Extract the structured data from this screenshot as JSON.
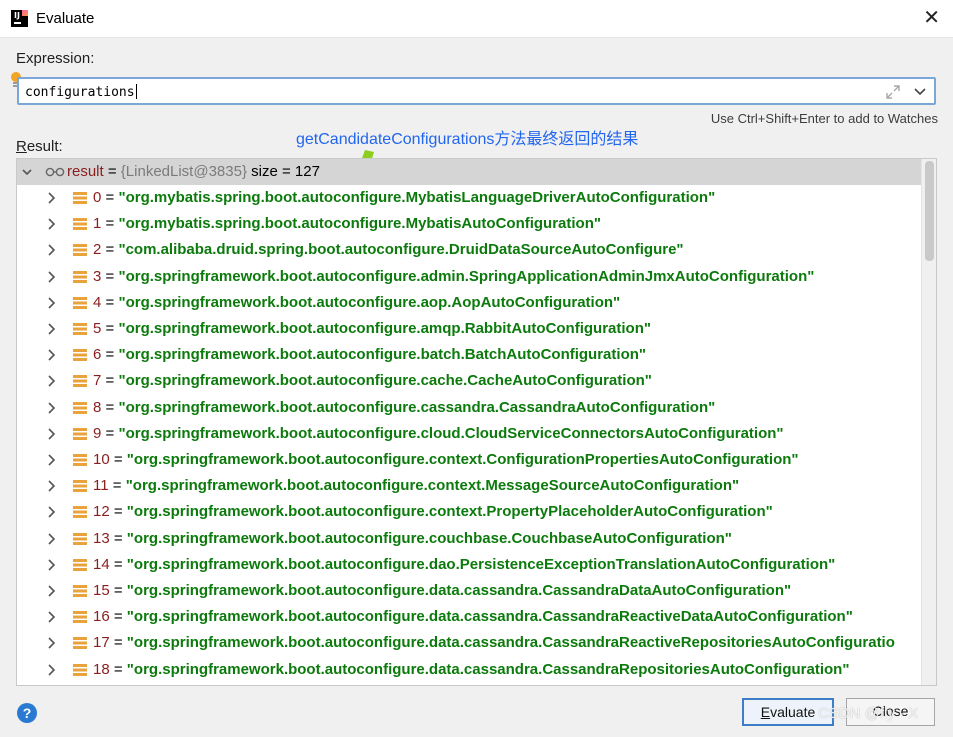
{
  "window": {
    "title": "Evaluate",
    "close_glyph": "✕"
  },
  "expression": {
    "label": "Expression:",
    "value": "configurations",
    "hint": "Use Ctrl+Shift+Enter to add to Watches"
  },
  "result": {
    "label_mnemonic": "R",
    "label_rest": "esult:",
    "annotation": "getCandidateConfigurations方法最终返回的结果",
    "root": {
      "name": "result",
      "eq": " = ",
      "type": "{LinkedList@3835}",
      "size": "  size = 127"
    },
    "items": [
      {
        "index": "0",
        "value": "\"org.mybatis.spring.boot.autoconfigure.MybatisLanguageDriverAutoConfiguration\""
      },
      {
        "index": "1",
        "value": "\"org.mybatis.spring.boot.autoconfigure.MybatisAutoConfiguration\""
      },
      {
        "index": "2",
        "value": "\"com.alibaba.druid.spring.boot.autoconfigure.DruidDataSourceAutoConfigure\""
      },
      {
        "index": "3",
        "value": "\"org.springframework.boot.autoconfigure.admin.SpringApplicationAdminJmxAutoConfiguration\""
      },
      {
        "index": "4",
        "value": "\"org.springframework.boot.autoconfigure.aop.AopAutoConfiguration\""
      },
      {
        "index": "5",
        "value": "\"org.springframework.boot.autoconfigure.amqp.RabbitAutoConfiguration\""
      },
      {
        "index": "6",
        "value": "\"org.springframework.boot.autoconfigure.batch.BatchAutoConfiguration\""
      },
      {
        "index": "7",
        "value": "\"org.springframework.boot.autoconfigure.cache.CacheAutoConfiguration\""
      },
      {
        "index": "8",
        "value": "\"org.springframework.boot.autoconfigure.cassandra.CassandraAutoConfiguration\""
      },
      {
        "index": "9",
        "value": "\"org.springframework.boot.autoconfigure.cloud.CloudServiceConnectorsAutoConfiguration\""
      },
      {
        "index": "10",
        "value": "\"org.springframework.boot.autoconfigure.context.ConfigurationPropertiesAutoConfiguration\""
      },
      {
        "index": "11",
        "value": "\"org.springframework.boot.autoconfigure.context.MessageSourceAutoConfiguration\""
      },
      {
        "index": "12",
        "value": "\"org.springframework.boot.autoconfigure.context.PropertyPlaceholderAutoConfiguration\""
      },
      {
        "index": "13",
        "value": "\"org.springframework.boot.autoconfigure.couchbase.CouchbaseAutoConfiguration\""
      },
      {
        "index": "14",
        "value": "\"org.springframework.boot.autoconfigure.dao.PersistenceExceptionTranslationAutoConfiguration\""
      },
      {
        "index": "15",
        "value": "\"org.springframework.boot.autoconfigure.data.cassandra.CassandraDataAutoConfiguration\""
      },
      {
        "index": "16",
        "value": "\"org.springframework.boot.autoconfigure.data.cassandra.CassandraReactiveDataAutoConfiguration\""
      },
      {
        "index": "17",
        "value": "\"org.springframework.boot.autoconfigure.data.cassandra.CassandraReactiveRepositoriesAutoConfiguratio"
      },
      {
        "index": "18",
        "value": "\"org.springframework.boot.autoconfigure.data.cassandra.CassandraRepositoriesAutoConfiguration\""
      }
    ]
  },
  "footer": {
    "help_glyph": "?",
    "evaluate_mnemonic": "E",
    "evaluate_rest": "valuate",
    "close_label": "Close",
    "watermark": "CSDN @fly - X"
  },
  "colors": {
    "string_value": "#0c7a0c",
    "index": "#8a1e1e",
    "annotation": "#2266ee",
    "focus_border": "#7aa7d6"
  }
}
